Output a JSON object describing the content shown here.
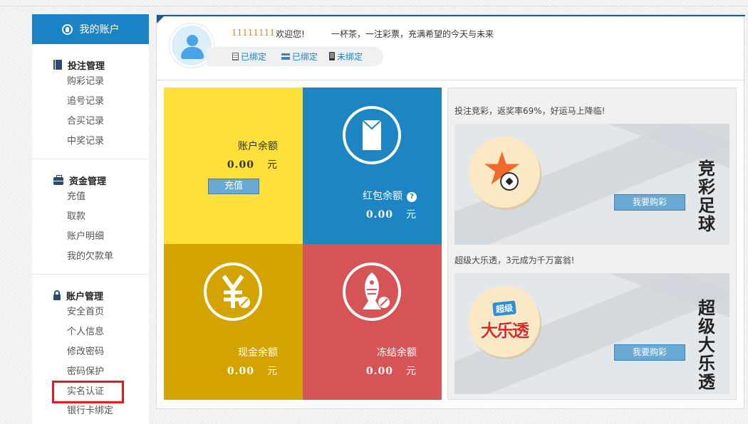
{
  "sidebar": {
    "header": "我的账户",
    "sections": [
      {
        "title": "投注管理",
        "items": [
          "购彩记录",
          "追号记录",
          "合买记录",
          "中奖记录"
        ]
      },
      {
        "title": "资金管理",
        "items": [
          "充值",
          "取款",
          "账户明细",
          "我的欠款单"
        ]
      },
      {
        "title": "账户管理",
        "items": [
          "安全首页",
          "个人信息",
          "修改密码",
          "密码保护",
          "实名认证",
          "银行卡绑定"
        ]
      }
    ]
  },
  "profile": {
    "username": "11111111",
    "welcome": "欢迎您!",
    "slogan": "一杯茶，一注彩票，充满希望的今天与未来",
    "bindings": [
      "已绑定",
      "已绑定",
      "未绑定"
    ]
  },
  "tiles": {
    "balance": {
      "label": "账户余额",
      "amount": "0.00",
      "unit": "元",
      "button": "充值"
    },
    "redpacket": {
      "label": "红包余额",
      "amount": "0.00",
      "unit": "元"
    },
    "cash": {
      "label": "现金余额",
      "amount": "0.00",
      "unit": "元"
    },
    "frozen": {
      "label": "冻结余额",
      "amount": "0.00",
      "unit": "元"
    }
  },
  "promos": [
    {
      "text": "投注竞彩，返奖率69%，好运马上降临!",
      "title": "竞彩足球",
      "button": "我要购彩"
    },
    {
      "text": "超级大乐透，3元成为千万富翁!",
      "title": "超级大乐透",
      "button": "我要购彩",
      "logo_top": "超级",
      "logo_main": "大乐透"
    }
  ],
  "colors": {
    "sidebar_header": "#1a83c6",
    "tile_yellow": "#fde039",
    "tile_blue": "#1e85c3",
    "tile_gold": "#d3a400",
    "tile_red": "#d65455",
    "highlight": "#e5191d"
  }
}
